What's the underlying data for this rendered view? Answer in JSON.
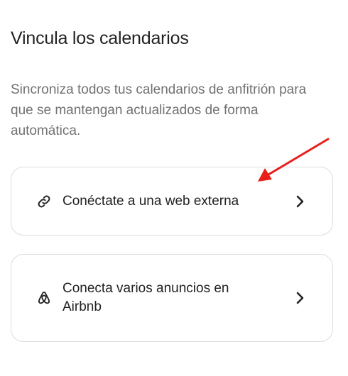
{
  "page": {
    "title": "Vincula los calendarios",
    "description": "Sincroniza todos tus calendarios de anfitrión para que se mantengan actualizados de forma automática."
  },
  "options": [
    {
      "label": "Conéctate a una web externa",
      "icon": "link-icon"
    },
    {
      "label": "Conecta varios anuncios en Airbnb",
      "icon": "airbnb-logo-icon"
    }
  ],
  "colors": {
    "text_primary": "#222222",
    "text_secondary": "#717171",
    "border": "#dddddd",
    "annotation_arrow": "#e8201b"
  }
}
